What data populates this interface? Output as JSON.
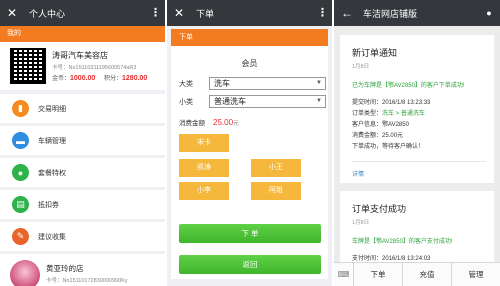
{
  "colors": {
    "topbar": "#34383c",
    "accent_orange": "#f47c20",
    "accent_green": "#3fb52c",
    "staff_yellow": "#f5b83c",
    "price_red": "#e52e2e"
  },
  "panel1": {
    "back_icon": "close-icon",
    "title": "个人中心",
    "more_icon": "more-vertical-icon",
    "section_label": "我的",
    "shop": {
      "name": "涛哥汽车美容店",
      "card_no": "卡号：No15110311195600574aR3",
      "balance_label": "金币：",
      "balance": "1000.00",
      "points_label": "积分：",
      "points": "1280.00"
    },
    "menu": [
      {
        "label": "交易明细",
        "icon": "bar-chart-icon",
        "color": "#f58a1f",
        "glyph": "▮"
      },
      {
        "label": "车辆管理",
        "icon": "car-icon",
        "color": "#2f8ee0",
        "glyph": "▬"
      },
      {
        "label": "套餐特权",
        "icon": "user-icon",
        "color": "#2eb24a",
        "glyph": "●"
      },
      {
        "label": "抵扣券",
        "icon": "ticket-icon",
        "color": "#2eb24a",
        "glyph": "▤"
      },
      {
        "label": "建议收集",
        "icon": "feedback-icon",
        "color": "#e9632a",
        "glyph": "✎"
      }
    ],
    "shop2": {
      "name": "黄亚玲的店",
      "card_no": "卡号：No15110172830000900Ky"
    }
  },
  "panel2": {
    "back_icon": "close-icon",
    "title": "下单",
    "more_icon": "more-vertical-icon",
    "header": "下单",
    "member_label": "会员",
    "category_label": "大类",
    "category_value": "洗车",
    "subcategory_label": "小类",
    "subcategory_value": "普通洗车",
    "amount_label": "消费金额",
    "amount": "25.00",
    "amount_unit": "元",
    "staff": [
      "宋卡",
      "凯涛",
      "小王",
      "小李",
      "阿姐"
    ],
    "submit": "下 单",
    "back": "返回"
  },
  "panel3": {
    "back_icon": "arrow-left-icon",
    "title": "车洁网店铺版",
    "profile_icon": "person-icon",
    "messages": [
      {
        "title": "新订单通知",
        "date": "1月8日",
        "headline": "已为车牌是【鄂AV2850】的客户下单成功!",
        "lines": [
          {
            "k": "提交时间：",
            "v": "2016/1/8 13:23:33",
            "green": false
          },
          {
            "k": "订单类型：",
            "v": "洗车 > 普通洗车",
            "green": true
          },
          {
            "k": "客户信息：",
            "v": "鄂AV2850",
            "green": false
          },
          {
            "k": "消费金额：",
            "v": "25.00元",
            "green": false
          },
          {
            "k": "",
            "v": "下单成功，等待客户确认！",
            "green": false
          }
        ],
        "detail": "详情"
      },
      {
        "title": "订单支付成功",
        "date": "1月8日",
        "headline": "车牌是【鄂AV2850】的客户支付成功!",
        "lines": [
          {
            "k": "支付时间：",
            "v": "2016/1/8 13:24:03",
            "green": false
          },
          {
            "k": "商品信息：",
            "v": "洗车 > 普通洗车",
            "green": true
          },
          {
            "k": "支付金额：",
            "v": "25.00元",
            "green": false
          },
          {
            "k": "",
            "v": "支付成功，客户确认下单！",
            "green": false
          }
        ]
      }
    ],
    "keyboard_icon": "keyboard-icon",
    "bottom_menu": [
      "下单",
      "充值",
      "管理"
    ]
  }
}
